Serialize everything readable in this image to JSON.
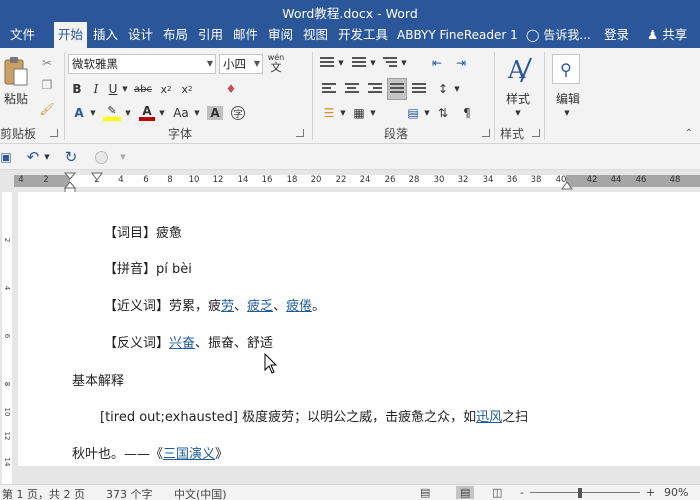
{
  "window": {
    "title": "Word教程.docx - Word"
  },
  "tabs": [
    {
      "label": "文件"
    },
    {
      "label": "开始"
    },
    {
      "label": "插入"
    },
    {
      "label": "设计"
    },
    {
      "label": "布局"
    },
    {
      "label": "引用"
    },
    {
      "label": "邮件"
    },
    {
      "label": "审阅"
    },
    {
      "label": "视图"
    },
    {
      "label": "开发工具"
    },
    {
      "label": "ABBYY FineReader 1"
    }
  ],
  "tellme": "告诉我...",
  "account": {
    "signin": "登录",
    "share": "共享"
  },
  "ribbon": {
    "clipboard": {
      "label": "剪贴板",
      "paste": "粘贴"
    },
    "font": {
      "label": "字体",
      "name": "微软雅黑",
      "size": "小四",
      "wen": "wén",
      "wen_char": "文",
      "aa": "Aa"
    },
    "paragraph": {
      "label": "段落"
    },
    "styles": {
      "label": "样式",
      "btn": "样式"
    },
    "editing": {
      "btn": "编辑"
    }
  },
  "ruler": {
    "ticks": [
      "4",
      "2",
      "2",
      "4",
      "6",
      "8",
      "10",
      "12",
      "14",
      "16",
      "18",
      "20",
      "22",
      "24",
      "26",
      "28",
      "30",
      "32",
      "34",
      "36",
      "38",
      "40",
      "42",
      "44",
      "46",
      "48"
    ]
  },
  "vruler": {
    "marks": [
      "2",
      "4",
      "6",
      "8",
      "10",
      "12",
      "14"
    ]
  },
  "document": {
    "line1": "【词目】疲惫",
    "line2": "【拼音】pí bèi",
    "line3_prefix": "【近义词】劳累，疲",
    "line3_link1": "劳",
    "line3_sep1": "、",
    "line3_link2": "疲乏",
    "line3_sep2": "、",
    "line3_link3": "疲倦",
    "line3_end": "。",
    "line4_prefix": "【反义词】",
    "line4_link": "兴奋",
    "line4_rest": "、振奋、舒适",
    "heading": "基本解释",
    "line6_prefix": "[tired out;exhausted] 极度疲劳；以明公之威，击疲惫之众，如",
    "line6_link": "迅风",
    "line6_end": "之扫",
    "line7_prefix": "秋叶也。——《",
    "line7_link": "三国演义",
    "line7_end": "》"
  },
  "status": {
    "page": "第 1 页，共 2 页",
    "words": "373 个字",
    "language": "中文(中国)",
    "zoom": "90%",
    "zoom_minus": "-",
    "zoom_plus": "+"
  }
}
